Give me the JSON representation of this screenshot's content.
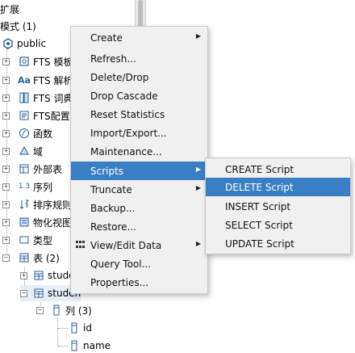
{
  "tree": {
    "extensions": "扩展",
    "schemas": "模式 (1)",
    "public": "public",
    "fts_templates": "FTS 模板",
    "fts_parsers": "FTS 解析",
    "fts_dicts": "FTS 词典",
    "fts_configs": "FTS配置",
    "functions": "函数",
    "domains": "域",
    "foreign_tables": "外部表",
    "sequences": "序列",
    "collations": "排序规则",
    "mat_views": "物化视图",
    "types": "类型",
    "tables": "表 (2)",
    "table1": "stude",
    "table2": "studen",
    "columns": "列 (3)",
    "col_id": "id",
    "col_name": "name",
    "seq_prefix": "1.3",
    "text_prefix": "Aa"
  },
  "context_menu": {
    "items": [
      {
        "label": "Create",
        "submenu": true
      },
      {
        "label": "Refresh...",
        "submenu": false
      },
      {
        "label": "Delete/Drop",
        "submenu": false
      },
      {
        "label": "Drop Cascade",
        "submenu": false
      },
      {
        "label": "Reset Statistics",
        "submenu": false
      },
      {
        "label": "Import/Export...",
        "submenu": false
      },
      {
        "label": "Maintenance...",
        "submenu": false
      },
      {
        "label": "Scripts",
        "submenu": true,
        "highlighted": true
      },
      {
        "label": "Truncate",
        "submenu": true
      },
      {
        "label": "Backup...",
        "submenu": false
      },
      {
        "label": "Restore...",
        "submenu": false
      },
      {
        "label": "View/Edit Data",
        "submenu": true
      },
      {
        "label": "Query Tool...",
        "submenu": false
      },
      {
        "label": "Properties...",
        "submenu": false
      }
    ]
  },
  "scripts_submenu": {
    "items": [
      {
        "label": "CREATE Script"
      },
      {
        "label": "DELETE Script",
        "highlighted": true
      },
      {
        "label": "INSERT Script"
      },
      {
        "label": "SELECT Script"
      },
      {
        "label": "UPDATE Script"
      }
    ]
  },
  "glyphs": {
    "expand": "+",
    "collapse": "−",
    "submenu_arrow": "▶"
  },
  "colors": {
    "highlight": "#3a7fc4",
    "menu_bg": "#f0f0f0"
  }
}
